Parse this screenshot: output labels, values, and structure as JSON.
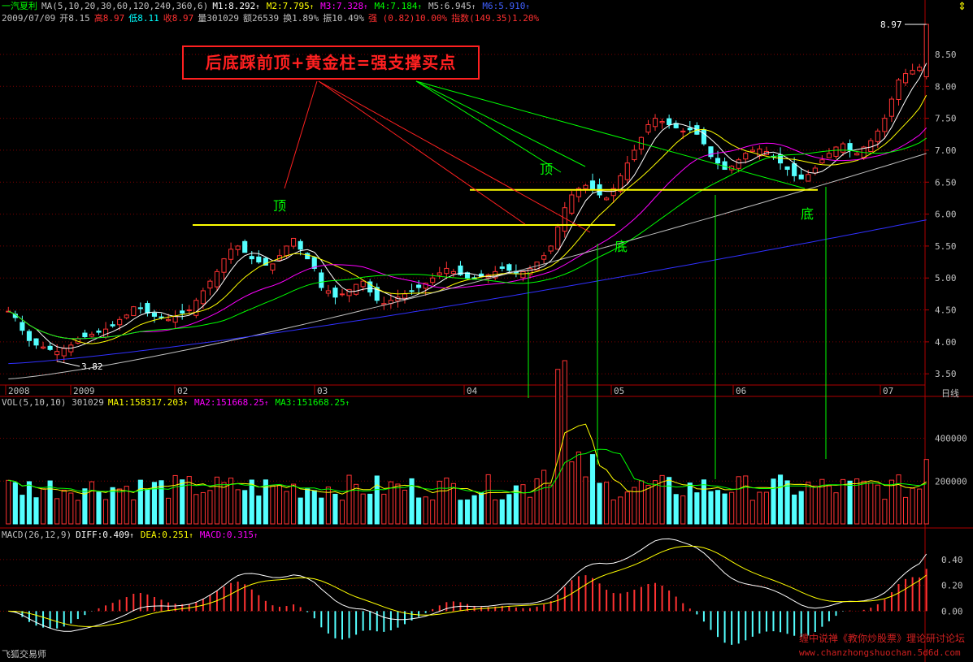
{
  "header": {
    "stock_name": "一汽夏利",
    "ma_params": "MA(5,10,20,30,60,120,240,360,6)",
    "ma_values": [
      {
        "label": "M1:8.292",
        "color": "#ffffff"
      },
      {
        "label": "M2:7.795",
        "color": "#ffff00"
      },
      {
        "label": "M3:7.328",
        "color": "#ff00ff"
      },
      {
        "label": "M4:7.184",
        "color": "#00ff00"
      },
      {
        "label": "M5:6.945",
        "color": "#c0c0c0"
      },
      {
        "label": "M6:5.910",
        "color": "#4060ff"
      }
    ],
    "quote": {
      "date": "2009/07/09",
      "open": "开8.15",
      "high": "高8.97",
      "low": "低8.11",
      "close": "收8.97",
      "volume": "量301029",
      "amount": "额26539",
      "turnover": "换1.89%",
      "amplitude": "振10.49%",
      "strength": "强 (0.82)10.00%",
      "index": "指数(149.35)1.20%"
    },
    "top_icon": "pin-icon"
  },
  "annotation": {
    "text": "后底踩前顶+黄金柱=强支撑买点",
    "labels": [
      "顶",
      "顶",
      "底",
      "底"
    ]
  },
  "footer": {
    "software": "飞狐交易师",
    "credit_line1": "缠中说禅《教你炒股票》理论研讨论坛",
    "credit_line2": "www.chanzhongshuochan.5d6d.com",
    "period": "日线"
  },
  "chart_data": [
    {
      "type": "candlestick",
      "panel": "price",
      "ylim": [
        3.35,
        8.97
      ],
      "yticks": [
        "3.50",
        "4.00",
        "4.50",
        "5.00",
        "5.50",
        "6.00",
        "6.50",
        "7.00",
        "7.50",
        "8.00",
        "8.50"
      ],
      "x_labels": [
        "2008",
        "2009",
        "02",
        "03",
        "04",
        "05",
        "06",
        "07"
      ],
      "max_label": "8.97",
      "min_label": "3.82",
      "support_levels": [
        5.83,
        6.38
      ],
      "closes": [
        4.48,
        4.38,
        4.18,
        4.02,
        3.95,
        3.92,
        3.88,
        3.85,
        3.9,
        3.95,
        4.05,
        4.08,
        4.12,
        4.15,
        4.2,
        4.25,
        4.35,
        4.42,
        4.55,
        4.52,
        4.45,
        4.4,
        4.38,
        4.35,
        4.4,
        4.45,
        4.5,
        4.65,
        4.8,
        4.95,
        5.1,
        5.3,
        5.45,
        5.5,
        5.4,
        5.3,
        5.25,
        5.2,
        5.22,
        5.35,
        5.5,
        5.62,
        5.45,
        5.3,
        5.15,
        4.85,
        4.8,
        4.7,
        4.75,
        4.82,
        4.9,
        4.95,
        4.78,
        4.65,
        4.6,
        4.65,
        4.7,
        4.75,
        4.8,
        4.85,
        4.92,
        5.0,
        5.08,
        5.15,
        5.1,
        5.05,
        5.0,
        4.98,
        5.02,
        5.05,
        5.1,
        5.15,
        5.12,
        5.08,
        5.1,
        5.15,
        5.25,
        5.35,
        5.5,
        5.8,
        6.1,
        6.3,
        6.4,
        6.45,
        6.38,
        6.3,
        6.25,
        6.4,
        6.6,
        6.8,
        7.0,
        7.2,
        7.4,
        7.5,
        7.45,
        7.4,
        7.35,
        7.3,
        7.32,
        7.25,
        7.1,
        6.9,
        6.8,
        6.7,
        6.75,
        6.85,
        6.95,
        7.0,
        7.02,
        6.98,
        6.9,
        6.8,
        6.7,
        6.6,
        6.55,
        6.62,
        6.72,
        6.85,
        6.95,
        7.05,
        7.1,
        7.0,
        6.95,
        7.05,
        7.15,
        7.3,
        7.5,
        7.8,
        8.1,
        8.2,
        8.25,
        8.3,
        8.97
      ],
      "ma_series": [
        {
          "label": "M1",
          "period": 5,
          "color": "#ffffff"
        },
        {
          "label": "M2",
          "period": 10,
          "color": "#ffff00"
        },
        {
          "label": "M3",
          "period": 20,
          "color": "#ff00ff"
        },
        {
          "label": "M4",
          "period": 30,
          "color": "#00ff00"
        },
        {
          "label": "M5",
          "value_start": 3.42,
          "value_end": 6.95,
          "color": "#c0c0c0"
        },
        {
          "label": "M6",
          "value_start": 3.66,
          "value_end": 5.91,
          "color": "#3030ff"
        }
      ]
    },
    {
      "type": "bar",
      "panel": "volume",
      "header": "VOL(5,10,10) 301029",
      "ma_labels": [
        {
          "label": "MA1:158317.203",
          "color": "#ffff00"
        },
        {
          "label": "MA2:151668.25",
          "color": "#ff00ff"
        },
        {
          "label": "MA3:151668.25",
          "color": "#00ff00"
        }
      ],
      "yticks": [
        "200000",
        "400000"
      ],
      "ylim": [
        0,
        550000
      ]
    },
    {
      "type": "bar",
      "panel": "macd",
      "header": "MACD(26,12,9)",
      "values": [
        {
          "label": "DIFF:0.409",
          "color": "#ffffff"
        },
        {
          "label": "DEA:0.251",
          "color": "#ffff00"
        },
        {
          "label": "MACD:0.315",
          "color": "#ff00ff"
        }
      ],
      "yticks": [
        "0.00",
        "0.20",
        "0.40"
      ],
      "ylim": [
        -0.3,
        0.55
      ]
    }
  ],
  "colors": {
    "up": "#ff3232",
    "down": "#54ffff",
    "grid": "#800000",
    "axis": "#b00000",
    "support": "#ffff00",
    "pointer_red": "#ff2020",
    "pointer_green": "#00ff00"
  }
}
